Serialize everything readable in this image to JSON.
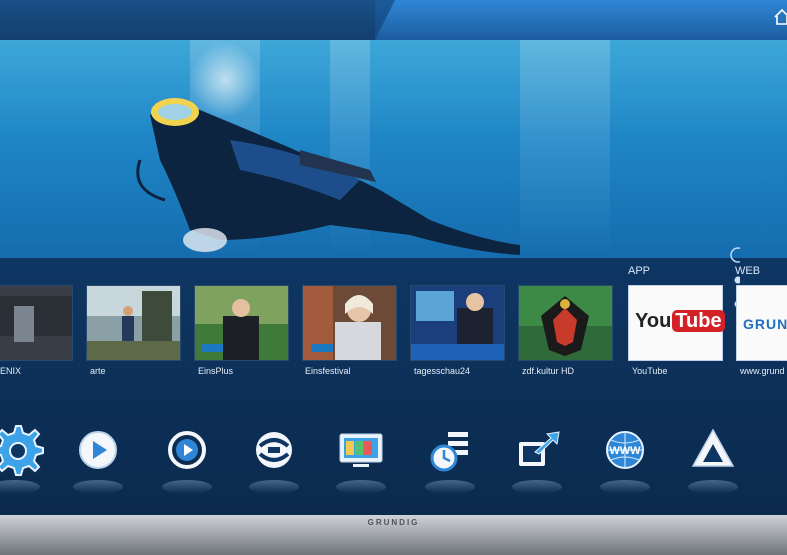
{
  "brand": "GRUNDIG",
  "sections": {
    "app": "APP",
    "web": "WEB"
  },
  "channels": [
    {
      "label": "ENIX"
    },
    {
      "label": "arte"
    },
    {
      "label": "EinsPlus"
    },
    {
      "label": "Einsfestival"
    },
    {
      "label": "tagesschau24"
    },
    {
      "label": "zdf.kultur HD"
    }
  ],
  "apps": [
    {
      "label": "YouTube",
      "logo_text": "You",
      "logo_tube": "Tube"
    },
    {
      "label": "www.grund",
      "logo_text": "GRUN"
    }
  ],
  "dock": [
    {
      "name": "settings-gear-icon"
    },
    {
      "name": "play-icon"
    },
    {
      "name": "media-player-icon"
    },
    {
      "name": "sharing-icon"
    },
    {
      "name": "tv-monitor-icon"
    },
    {
      "name": "timer-list-icon"
    },
    {
      "name": "share-export-icon"
    },
    {
      "name": "www-browser-icon"
    },
    {
      "name": "triangle-app-icon"
    }
  ],
  "colors": {
    "accent": "#2f86d6",
    "youtube_red": "#d42027",
    "panel": "#0e3663"
  }
}
